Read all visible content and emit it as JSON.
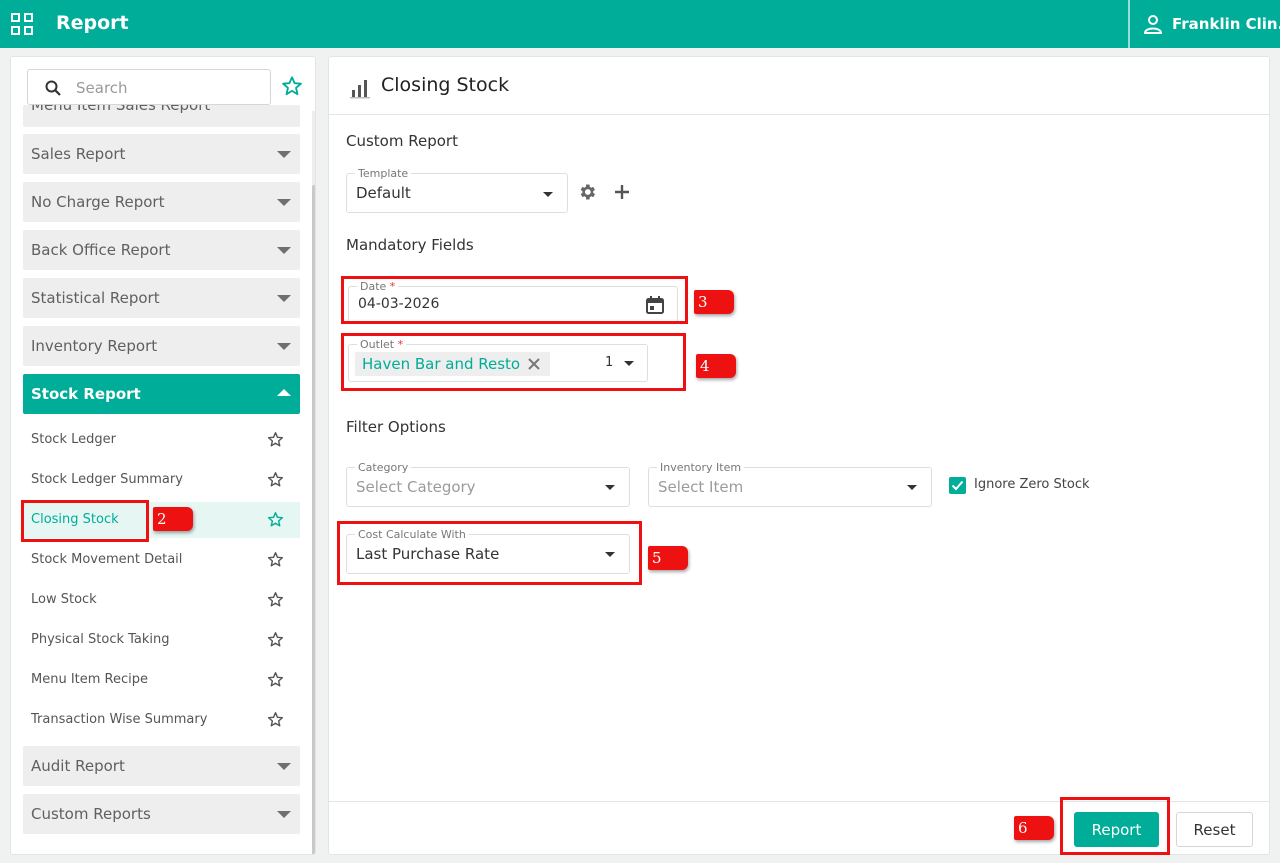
{
  "topbar": {
    "title": "Report",
    "user_name": "Franklin Clin..."
  },
  "sidebar": {
    "search_placeholder": "Search",
    "cut_category_label": "Menu Item Sales Report",
    "categories": {
      "sales": "Sales Report",
      "no_charge": "No Charge Report",
      "back_office": "Back Office Report",
      "statistical": "Statistical Report",
      "inventory": "Inventory Report",
      "stock": "Stock Report",
      "audit": "Audit Report",
      "custom": "Custom Reports"
    },
    "stock_items": [
      "Stock Ledger",
      "Stock Ledger Summary",
      "Closing Stock",
      "Stock Movement Detail",
      "Low Stock",
      "Physical Stock Taking",
      "Menu Item Recipe",
      "Transaction Wise Summary"
    ],
    "selected_item": "Closing Stock"
  },
  "main": {
    "title": "Closing Stock",
    "custom_report": {
      "section_title": "Custom Report",
      "template_label": "Template",
      "template_value": "Default"
    },
    "mandatory": {
      "section_title": "Mandatory Fields",
      "date_label": "Date",
      "date_value": "04-03-2026",
      "outlet_label": "Outlet",
      "outlet_chip": "Haven Bar and Resto",
      "outlet_count": "1",
      "required_marker": "*"
    },
    "filters": {
      "section_title": "Filter Options",
      "category_label": "Category",
      "category_placeholder": "Select Category",
      "item_label": "Inventory Item",
      "item_placeholder": "Select Item",
      "ignore_zero_label": "Ignore Zero Stock",
      "ignore_zero_checked": true,
      "cost_label": "Cost Calculate With",
      "cost_value": "Last Purchase Rate"
    },
    "footer": {
      "report_button": "Report",
      "reset_button": "Reset"
    }
  },
  "annotations": [
    "2",
    "3",
    "4",
    "5",
    "6"
  ],
  "colors": {
    "accent": "#00ad98",
    "highlight": "#ee1111"
  }
}
